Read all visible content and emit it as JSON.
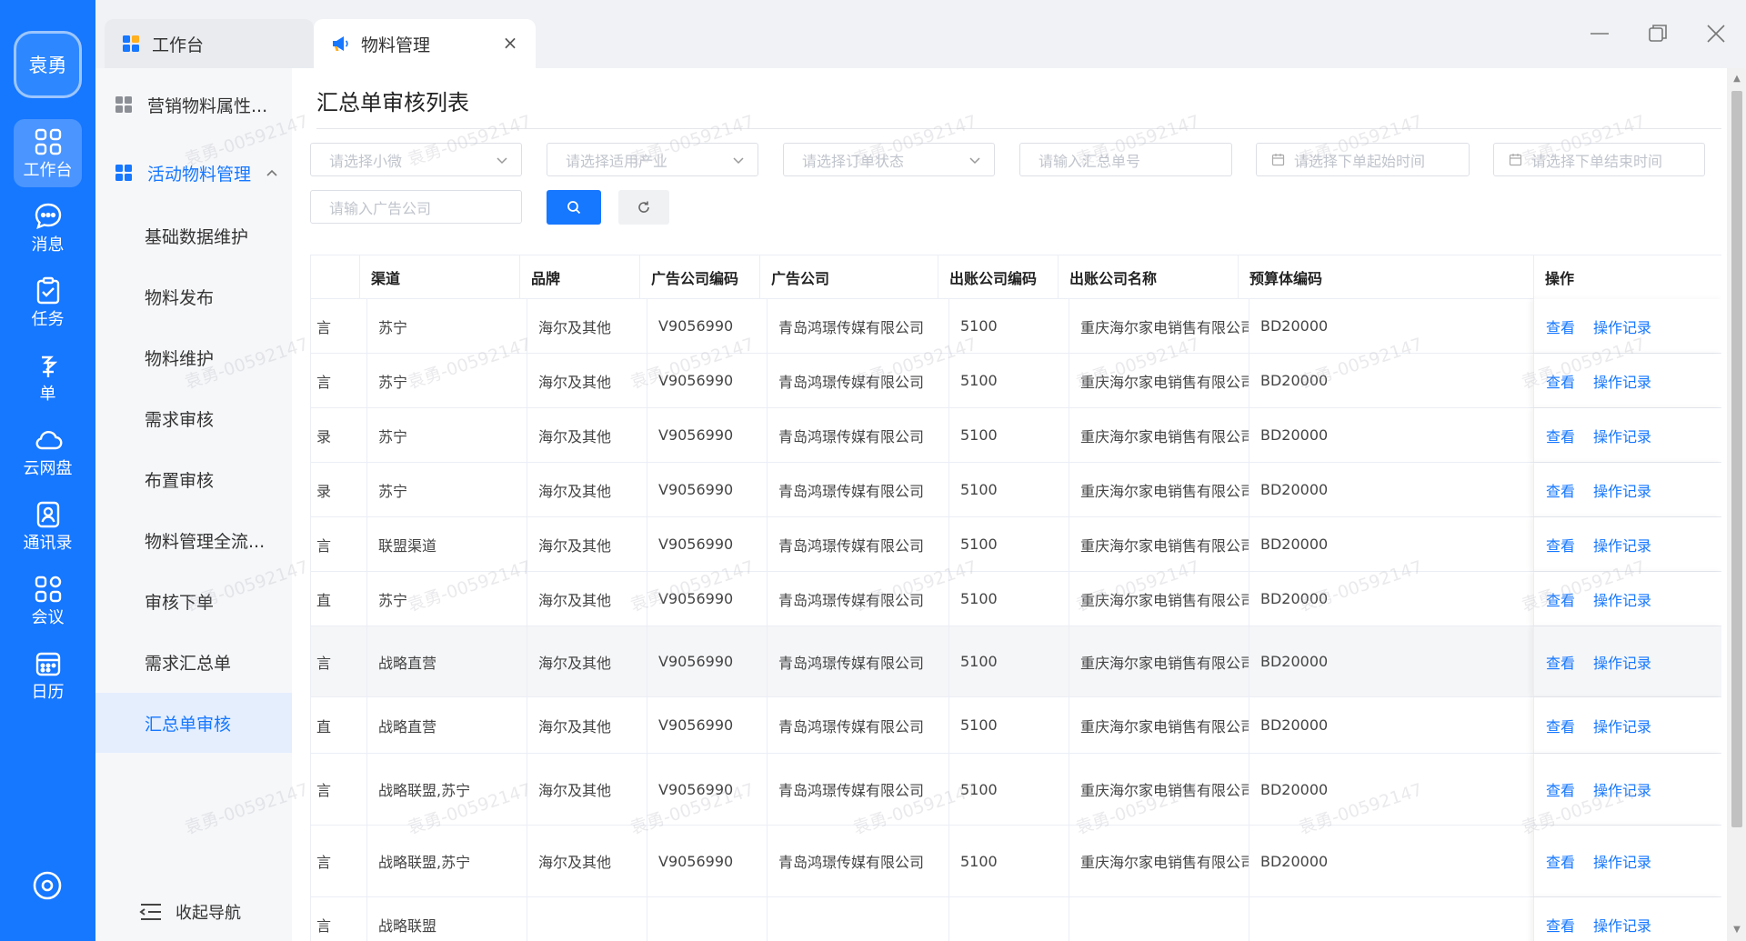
{
  "user": {
    "avatar_text": "袁勇"
  },
  "rail": {
    "items": [
      {
        "label": "工作台",
        "icon": "grid-apps-icon",
        "active": true
      },
      {
        "label": "消息",
        "icon": "chat-bubble-icon",
        "active": false
      },
      {
        "label": "任务",
        "icon": "clipboard-check-icon",
        "active": false
      },
      {
        "label": "单",
        "icon": "form-document-icon",
        "active": false
      },
      {
        "label": "云网盘",
        "icon": "cloud-icon",
        "active": false
      },
      {
        "label": "通讯录",
        "icon": "contacts-icon",
        "active": false
      },
      {
        "label": "会议",
        "icon": "meeting-grid-icon",
        "active": false
      },
      {
        "label": "日历",
        "icon": "calendar-icon",
        "active": false
      }
    ],
    "settings_icon": "settings-ring-icon"
  },
  "tabs": {
    "workbench_label": "工作台",
    "material_label": "物料管理",
    "close_glyph": "×"
  },
  "sidebar": {
    "group_marketing": "营销物料属性...",
    "group_activity": "活动物料管理",
    "items": [
      {
        "label": "基础数据维护"
      },
      {
        "label": "物料发布"
      },
      {
        "label": "物料维护"
      },
      {
        "label": "需求审核"
      },
      {
        "label": "布置审核"
      },
      {
        "label": "物料管理全流..."
      },
      {
        "label": "审核下单"
      },
      {
        "label": "需求汇总单"
      },
      {
        "label": "汇总单审核",
        "active": true
      }
    ],
    "collapse_label": "收起导航"
  },
  "main": {
    "title": "汇总单审核列表",
    "filters": {
      "micro": "请选择小微",
      "industry": "请选择适用产业",
      "order_status": "请选择订单状态",
      "summary_no": "请输入汇总单号",
      "start_time": "请选择下单起始时间",
      "end_time": "请选择下单结束时间",
      "ad_company": "请输入广告公司"
    }
  },
  "table": {
    "columns": [
      "",
      "渠道",
      "品牌",
      "广告公司编码",
      "广告公司",
      "出账公司编码",
      "出账公司名称",
      "预算体编码",
      "操作"
    ],
    "rows": [
      {
        "lead": "言",
        "channel": "苏宁",
        "brand": "海尔及其他",
        "ad_code": "V9056990",
        "ad_company": "青岛鸿璟传媒有限公司",
        "bill_code": "5100",
        "bill_company": "重庆海尔家电销售有限公司",
        "budget_code": "BD20000"
      },
      {
        "lead": "言",
        "channel": "苏宁",
        "brand": "海尔及其他",
        "ad_code": "V9056990",
        "ad_company": "青岛鸿璟传媒有限公司",
        "bill_code": "5100",
        "bill_company": "重庆海尔家电销售有限公司",
        "budget_code": "BD20000"
      },
      {
        "lead": "录",
        "channel": "苏宁",
        "brand": "海尔及其他",
        "ad_code": "V9056990",
        "ad_company": "青岛鸿璟传媒有限公司",
        "bill_code": "5100",
        "bill_company": "重庆海尔家电销售有限公司",
        "budget_code": "BD20000"
      },
      {
        "lead": "录",
        "channel": "苏宁",
        "brand": "海尔及其他",
        "ad_code": "V9056990",
        "ad_company": "青岛鸿璟传媒有限公司",
        "bill_code": "5100",
        "bill_company": "重庆海尔家电销售有限公司",
        "budget_code": "BD20000"
      },
      {
        "lead": "言",
        "channel": "联盟渠道",
        "brand": "海尔及其他",
        "ad_code": "V9056990",
        "ad_company": "青岛鸿璟传媒有限公司",
        "bill_code": "5100",
        "bill_company": "重庆海尔家电销售有限公司",
        "budget_code": "BD20000"
      },
      {
        "lead": "直",
        "channel": "苏宁",
        "brand": "海尔及其他",
        "ad_code": "V9056990",
        "ad_company": "青岛鸿璟传媒有限公司",
        "bill_code": "5100",
        "bill_company": "重庆海尔家电销售有限公司",
        "budget_code": "BD20000"
      },
      {
        "lead": "言",
        "channel": "战略直营",
        "brand": "海尔及其他",
        "ad_code": "V9056990",
        "ad_company": "青岛鸿璟传媒有限公司",
        "bill_code": "5100",
        "bill_company": "重庆海尔家电销售有限公司",
        "budget_code": "BD20000",
        "highlight": true
      },
      {
        "lead": "直",
        "channel": "战略直营",
        "brand": "海尔及其他",
        "ad_code": "V9056990",
        "ad_company": "青岛鸿璟传媒有限公司",
        "bill_code": "5100",
        "bill_company": "重庆海尔家电销售有限公司",
        "budget_code": "BD20000"
      },
      {
        "lead": "言",
        "channel": "战略联盟,苏宁",
        "brand": "海尔及其他",
        "ad_code": "V9056990",
        "ad_company": "青岛鸿璟传媒有限公司",
        "bill_code": "5100",
        "bill_company": "重庆海尔家电销售有限公司",
        "budget_code": "BD20000"
      },
      {
        "lead": "言",
        "channel": "战略联盟,苏宁",
        "brand": "海尔及其他",
        "ad_code": "V9056990",
        "ad_company": "青岛鸿璟传媒有限公司",
        "bill_code": "5100",
        "bill_company": "重庆海尔家电销售有限公司",
        "budget_code": "BD20000"
      },
      {
        "lead": "言",
        "channel": "战略联盟",
        "brand": "",
        "ad_code": "",
        "ad_company": "",
        "bill_code": "",
        "bill_company": "",
        "budget_code": ""
      }
    ],
    "op_view": "查看",
    "op_log": "操作记录"
  },
  "watermark": "袁勇-00592147",
  "colors": {
    "primary": "#1677ff",
    "rail_bg": "#1677ff",
    "sidebar_bg": "#f6f7f9",
    "active_item_bg": "#e4eefd"
  }
}
